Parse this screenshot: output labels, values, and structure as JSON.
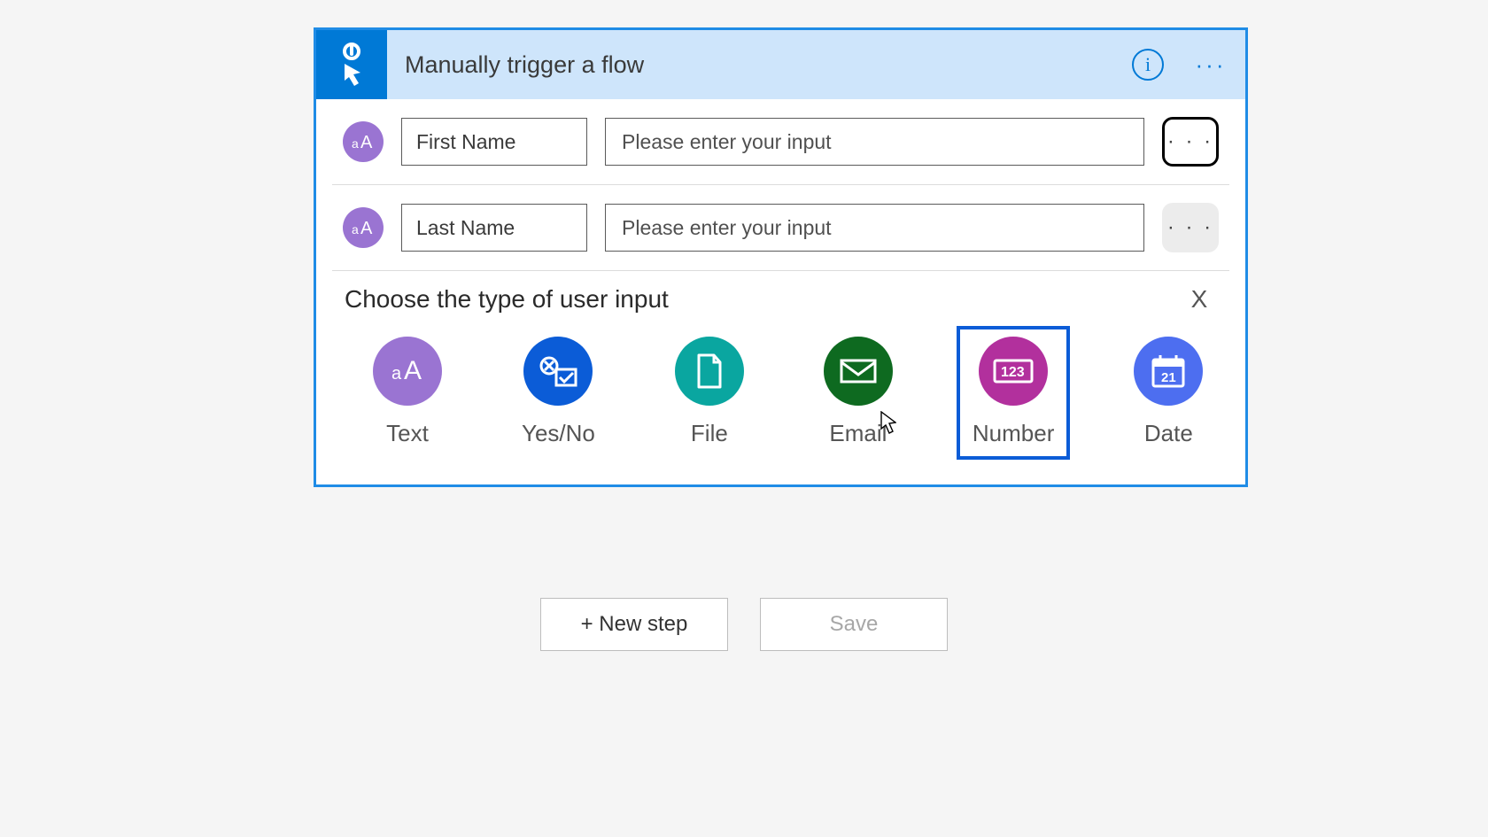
{
  "header": {
    "title": "Manually trigger a flow",
    "info_label": "i",
    "more_label": "···"
  },
  "inputs": [
    {
      "name": "First Name",
      "placeholder": "Please enter your input",
      "type_icon": "aA",
      "more_focused": true
    },
    {
      "name": "Last Name",
      "placeholder": "Please enter your input",
      "type_icon": "aA",
      "more_focused": false
    }
  ],
  "chooser": {
    "title": "Choose the type of user input",
    "close_label": "X",
    "options": [
      {
        "key": "text",
        "label": "Text"
      },
      {
        "key": "yesno",
        "label": "Yes/No"
      },
      {
        "key": "file",
        "label": "File"
      },
      {
        "key": "email",
        "label": "Email"
      },
      {
        "key": "number",
        "label": "Number",
        "selected": true
      },
      {
        "key": "date",
        "label": "Date"
      }
    ]
  },
  "footer": {
    "new_step_label": "+ New step",
    "save_label": "Save"
  }
}
